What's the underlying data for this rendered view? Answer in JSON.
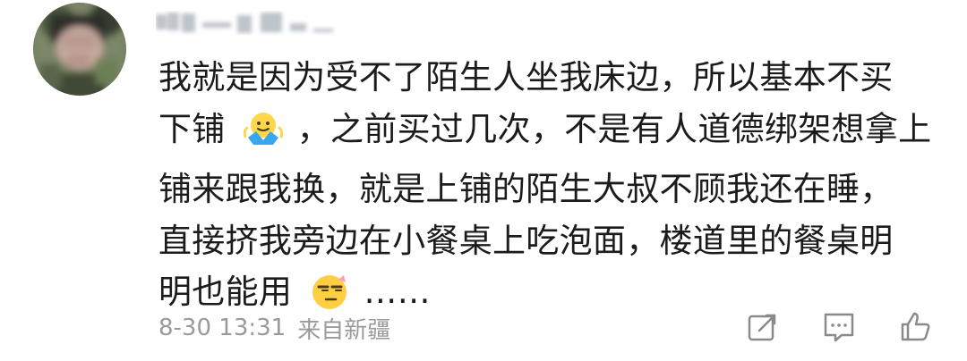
{
  "comment": {
    "lines": [
      "我就是因为受不了陌生人坐我床边，所以基本不买",
      "下铺",
      "，之前买过几次，不是有人道德绑架想拿上",
      "铺来跟我换，就是上铺的陌生大叔不顾我还在睡，",
      "直接挤我旁边在小餐桌上吃泡面，楼道里的餐桌明",
      "明也能用",
      "……"
    ],
    "emojis": [
      "shrug-emoji",
      "side-eye-emoji"
    ]
  },
  "meta": {
    "timestamp": "8-30 13:31",
    "location": "来自新疆"
  },
  "actions": {
    "share_icon": "share-icon",
    "comment_icon": "comment-icon",
    "like_icon": "like-icon"
  },
  "colors": {
    "text": "#1b1b1b",
    "meta": "#9a9a9a",
    "icon": "#8a8a8a"
  }
}
